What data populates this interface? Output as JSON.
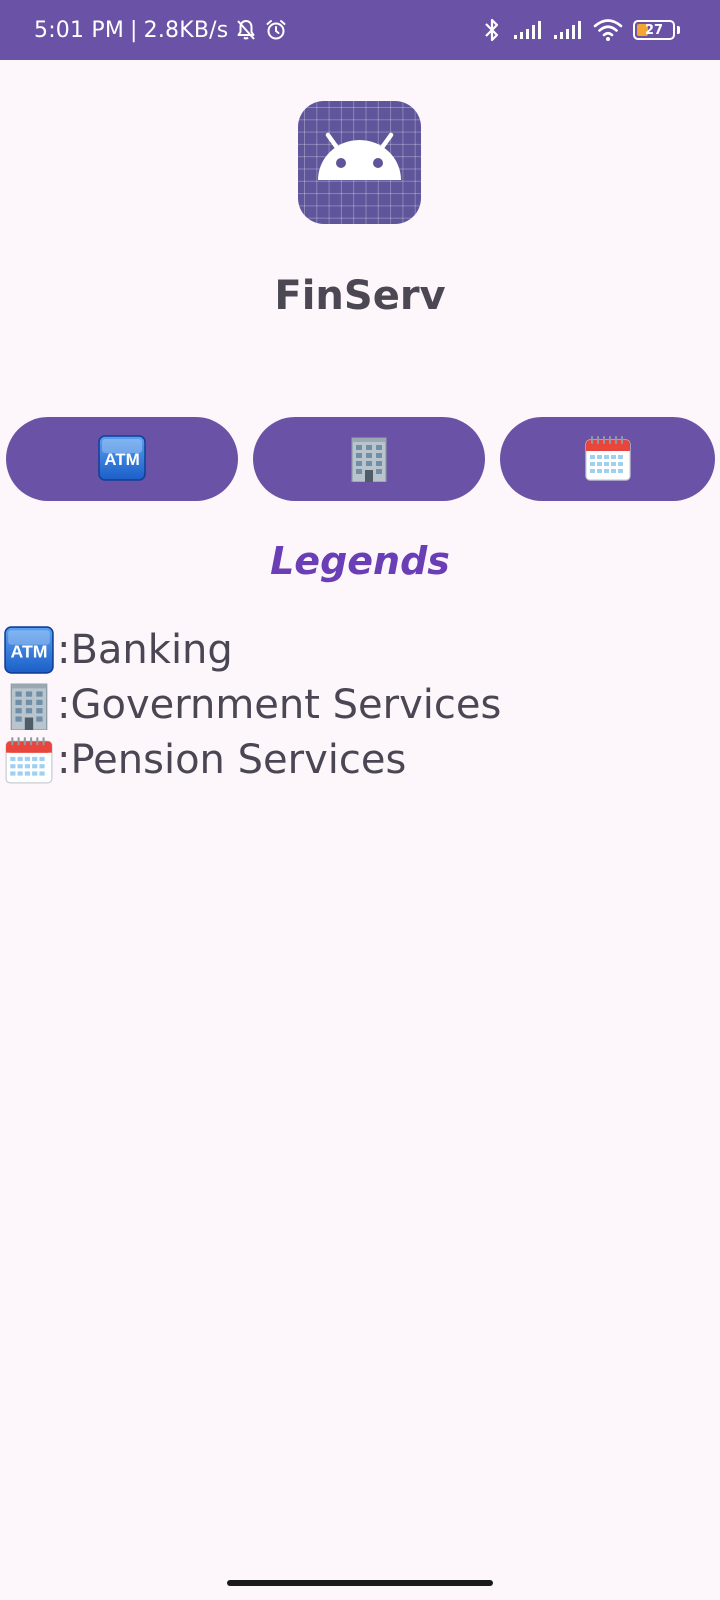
{
  "status_bar": {
    "time": "5:01 PM",
    "separator": "|",
    "network_speed": "2.8KB/s",
    "battery_level": "27",
    "icons": [
      "bell-off-icon",
      "alarm-icon",
      "bluetooth-icon",
      "signal-icon",
      "signal-icon",
      "wifi-icon",
      "battery-icon"
    ]
  },
  "app": {
    "icon": "android-icon",
    "title": "FinServ"
  },
  "buttons": [
    {
      "icon": "atm-icon"
    },
    {
      "icon": "office-building-icon"
    },
    {
      "icon": "calendar-icon"
    }
  ],
  "legends": {
    "heading": "Legends",
    "items": [
      {
        "icon": "atm-icon",
        "label": ":Banking"
      },
      {
        "icon": "office-building-icon",
        "label": ":Government Services"
      },
      {
        "icon": "calendar-icon",
        "label": ":Pension Services"
      }
    ]
  },
  "colors": {
    "primary": "#6a53a6",
    "background": "#fdf7fc",
    "title_text": "#4b4854",
    "legend_heading": "#6a3fb5",
    "battery_fill": "#f2a531"
  }
}
